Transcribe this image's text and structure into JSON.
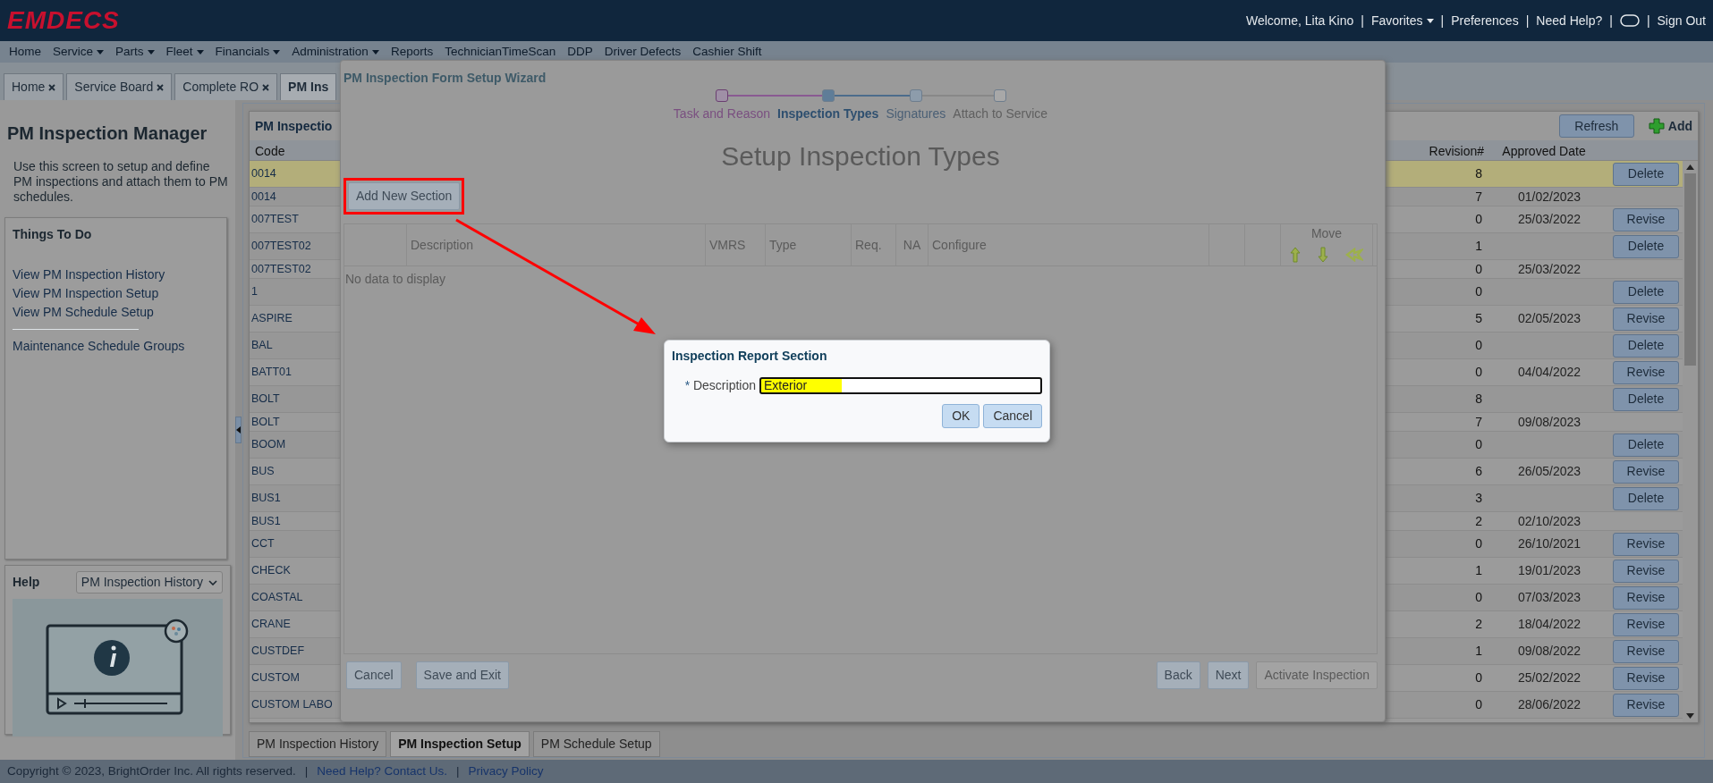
{
  "header": {
    "logo": "EMDECS",
    "items": [
      {
        "kind": "text",
        "label": "Welcome, Lita Kino"
      },
      {
        "kind": "separator",
        "label": "|"
      },
      {
        "kind": "menu",
        "label": "Favorites"
      },
      {
        "kind": "separator",
        "label": "|"
      },
      {
        "kind": "link",
        "label": "Preferences"
      },
      {
        "kind": "separator",
        "label": "|"
      },
      {
        "kind": "link",
        "label": "Need Help?"
      },
      {
        "kind": "separator",
        "label": "|"
      },
      {
        "kind": "toggle"
      },
      {
        "kind": "separator",
        "label": "|"
      },
      {
        "kind": "link",
        "label": "Sign Out"
      }
    ]
  },
  "menu": [
    {
      "label": "Home",
      "dropdown": false
    },
    {
      "label": "Service",
      "dropdown": true
    },
    {
      "label": "Parts",
      "dropdown": true
    },
    {
      "label": "Fleet",
      "dropdown": true
    },
    {
      "label": "Financials",
      "dropdown": true
    },
    {
      "label": "Administration",
      "dropdown": true
    },
    {
      "label": "Reports",
      "dropdown": false
    },
    {
      "label": "TechnicianTimeScan",
      "dropdown": false
    },
    {
      "label": "DDP",
      "dropdown": false
    },
    {
      "label": "Driver Defects",
      "dropdown": false
    },
    {
      "label": "Cashier Shift",
      "dropdown": false
    }
  ],
  "tabs": [
    {
      "label": "Home",
      "selected": false,
      "closable": true
    },
    {
      "label": "Service Board",
      "selected": false,
      "closable": true
    },
    {
      "label": "Complete RO",
      "selected": false,
      "closable": true
    },
    {
      "label": "PM Ins",
      "selected": true,
      "closable": false
    }
  ],
  "sidebar": {
    "title": "PM Inspection Manager",
    "description": "Use this screen to setup and define PM inspections and attach them to PM schedules.",
    "todo": {
      "title": "Things To Do",
      "groups": [
        {
          "links": [
            "View PM Inspection History",
            "View PM Inspection Setup",
            "View PM Schedule Setup"
          ]
        },
        {
          "links": [
            "Maintenance Schedule Groups"
          ]
        }
      ]
    },
    "help": {
      "title": "Help",
      "topic": "PM Inspection History"
    }
  },
  "list": {
    "title": "PM Inspectio",
    "refresh": "Refresh",
    "add": "Add",
    "columns": [
      "Code",
      "Revision#",
      "Approved Date"
    ],
    "rows": [
      {
        "code": "0014",
        "revision": "8",
        "action": "Delete",
        "selected": true
      },
      {
        "code": "0014",
        "revision": "7",
        "approved": "01/02/2023",
        "selected": false
      },
      {
        "code": "007TEST",
        "revision": "0",
        "approved": "25/03/2022",
        "action": "Revise",
        "selected": false
      },
      {
        "code": "007TEST02",
        "revision": "1",
        "action": "Delete",
        "selected": false
      },
      {
        "code": "007TEST02",
        "revision": "0",
        "approved": "25/03/2022",
        "selected": false
      },
      {
        "code": "1",
        "revision": "0",
        "action": "Delete",
        "selected": false
      },
      {
        "code": "ASPIRE",
        "revision": "5",
        "approved": "02/05/2023",
        "action": "Revise",
        "selected": false
      },
      {
        "code": "BAL",
        "revision": "0",
        "action": "Delete",
        "selected": false
      },
      {
        "code": "BATT01",
        "revision": "0",
        "approved": "04/04/2022",
        "action": "Revise",
        "selected": false
      },
      {
        "code": "BOLT",
        "revision": "8",
        "action": "Delete",
        "selected": false
      },
      {
        "code": "BOLT",
        "revision": "7",
        "approved": "09/08/2023",
        "selected": false
      },
      {
        "code": "BOOM",
        "revision": "0",
        "action": "Delete",
        "selected": false
      },
      {
        "code": "BUS",
        "revision": "6",
        "approved": "26/05/2023",
        "action": "Revise",
        "selected": false
      },
      {
        "code": "BUS1",
        "revision": "3",
        "action": "Delete",
        "selected": false
      },
      {
        "code": "BUS1",
        "revision": "2",
        "approved": "02/10/2023",
        "selected": false
      },
      {
        "code": "CCT",
        "revision": "0",
        "approved": "26/10/2021",
        "action": "Revise",
        "selected": false
      },
      {
        "code": "CHECK",
        "revision": "1",
        "approved": "19/01/2023",
        "action": "Revise",
        "selected": false
      },
      {
        "code": "COASTAL",
        "revision": "0",
        "approved": "07/03/2023",
        "action": "Revise",
        "selected": false
      },
      {
        "code": "CRANE",
        "revision": "2",
        "approved": "18/04/2022",
        "action": "Revise",
        "selected": false
      },
      {
        "code": "CUSTDEF",
        "revision": "1",
        "approved": "09/08/2022",
        "action": "Revise",
        "selected": false
      },
      {
        "code": "CUSTOM",
        "revision": "0",
        "approved": "25/02/2022",
        "action": "Revise",
        "selected": false
      },
      {
        "code": "CUSTOM LABO",
        "revision": "0",
        "approved": "28/06/2022",
        "action": "Revise",
        "selected": false
      }
    ]
  },
  "bottom_tabs": [
    {
      "label": "PM Inspection History",
      "selected": false
    },
    {
      "label": "PM Inspection Setup",
      "selected": true
    },
    {
      "label": "PM Schedule Setup",
      "selected": false
    }
  ],
  "footer": {
    "items": [
      {
        "kind": "text",
        "label": "Copyright © 2023, BrightOrder Inc. All rights reserved."
      },
      {
        "kind": "separator",
        "label": "|"
      },
      {
        "kind": "link",
        "label": "Need Help? Contact Us."
      },
      {
        "kind": "separator",
        "label": "|"
      },
      {
        "kind": "link",
        "label": "Privacy Policy"
      }
    ]
  },
  "wizard": {
    "title": "PM Inspection Form Setup Wizard",
    "steps": [
      {
        "label": "Task and Reason",
        "selected": false,
        "completed": true,
        "disabled": false
      },
      {
        "label": "Inspection Types",
        "selected": true,
        "completed": false,
        "disabled": false
      },
      {
        "label": "Signatures",
        "selected": false,
        "completed": false,
        "disabled": false
      },
      {
        "label": "Attach to Service",
        "selected": false,
        "completed": false,
        "disabled": true
      }
    ],
    "heading": "Setup Inspection Types",
    "add_section": "Add New Section",
    "grid": {
      "columns": [
        "Description",
        "VMRS",
        "Type",
        "Req.",
        "NA",
        "Configure"
      ],
      "move": "Move",
      "empty": "No data to display"
    },
    "buttons_left": [
      {
        "label": "Cancel",
        "disabled": false
      },
      {
        "label": "Save and Exit",
        "disabled": false
      }
    ],
    "buttons_right": [
      {
        "label": "Back",
        "disabled": false
      },
      {
        "label": "Next",
        "disabled": false
      },
      {
        "label": "Activate Inspection",
        "disabled": true
      }
    ]
  },
  "dialog": {
    "title": "Inspection Report Section",
    "field": {
      "required_mark": "*",
      "label": "Description",
      "value": "Exterior"
    },
    "buttons": [
      "OK",
      "Cancel"
    ]
  }
}
